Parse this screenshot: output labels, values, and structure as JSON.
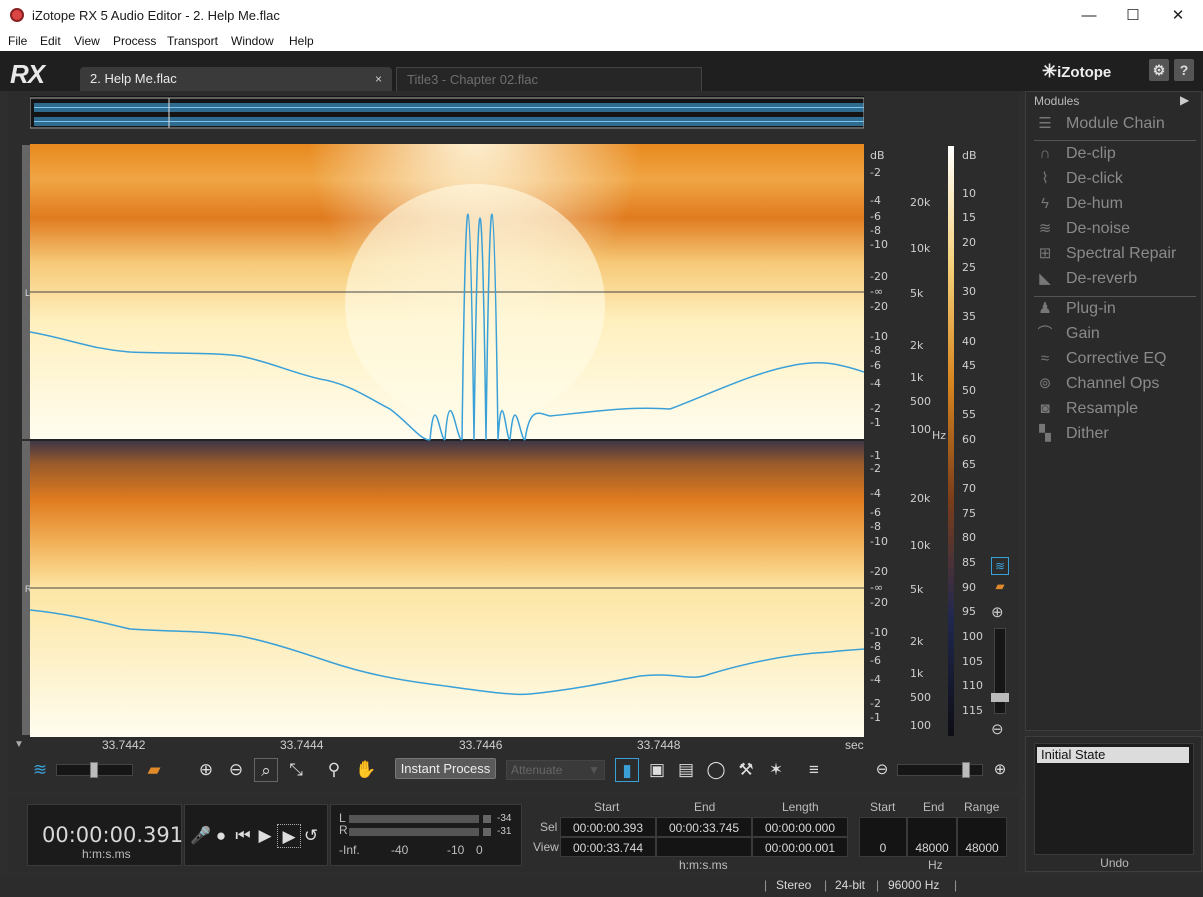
{
  "window": {
    "title": "iZotope RX 5 Audio Editor - 2. Help Me.flac",
    "minimize": "—",
    "maximize": "☐",
    "close": "✕"
  },
  "menu": [
    "File",
    "Edit",
    "View",
    "Process",
    "Transport",
    "Window",
    "Help"
  ],
  "header": {
    "logo": "RX",
    "brand": "iZotope",
    "settings": "⚙",
    "help": "?"
  },
  "tabs": [
    {
      "label": "2. Help Me.flac",
      "close": "×",
      "active": true
    },
    {
      "label": "Title3 - Chapter 02.flac",
      "active": false
    }
  ],
  "channels": [
    "L",
    "R"
  ],
  "db_axis_top": [
    "dB",
    "-2",
    "-4",
    "-6",
    "-8",
    "-10",
    "-20",
    "-∞",
    "-20",
    "-10",
    "-8",
    "-6",
    "-4",
    "-2",
    "-1"
  ],
  "db_axis_bottom": [
    "-1",
    "-2",
    "-4",
    "-6",
    "-8",
    "-10",
    "-20",
    "-∞",
    "-20",
    "-10",
    "-8",
    "-6",
    "-4",
    "-2",
    "-1"
  ],
  "hz_axis_top": [
    "20k",
    "10k",
    "5k",
    "2k",
    "1k",
    "500",
    "100"
  ],
  "hz_axis_bottom": [
    "20k",
    "10k",
    "5k",
    "2k",
    "1k",
    "500",
    "100"
  ],
  "hz_unit": "Hz",
  "colorbar": [
    "dB",
    "10",
    "15",
    "20",
    "25",
    "30",
    "35",
    "40",
    "45",
    "50",
    "55",
    "60",
    "65",
    "70",
    "75",
    "80",
    "85",
    "90",
    "95",
    "100",
    "105",
    "110",
    "115"
  ],
  "time_axis": [
    "33.7442",
    "33.7444",
    "33.7446",
    "33.7448",
    "sec"
  ],
  "toolbar": {
    "instant_process": "Instant Process",
    "attenuate": "Attenuate"
  },
  "transport": {
    "time": "00:00:00.391",
    "time_format": "h:m:s.ms",
    "meter_L": "L",
    "meter_R": "R",
    "peak_L": "-34",
    "peak_R": "-31",
    "meter_scale": [
      "-Inf.",
      "-40",
      "-10",
      "0"
    ]
  },
  "selection": {
    "headers": [
      "Start",
      "End",
      "Length"
    ],
    "sel_label": "Sel",
    "view_label": "View",
    "sel": [
      "00:00:00.393",
      "00:00:33.745",
      "00:00:00.000"
    ],
    "view": [
      "00:00:33.744",
      "",
      "00:00:00.001"
    ],
    "unit": "h:m:s.ms"
  },
  "frequency": {
    "headers": [
      "Start",
      "End",
      "Range"
    ],
    "values": [
      "0",
      "48000",
      "48000"
    ],
    "unit": "Hz"
  },
  "status": {
    "channels": "Stereo",
    "bitdepth": "24-bit",
    "samplerate": "96000 Hz"
  },
  "modules": {
    "header": "Modules",
    "items": [
      {
        "label": "Module Chain",
        "icon": "module-chain-icon",
        "glyph": "☰"
      },
      {
        "label": "De-clip",
        "icon": "de-clip-icon",
        "glyph": "∩"
      },
      {
        "label": "De-click",
        "icon": "de-click-icon",
        "glyph": "⌇"
      },
      {
        "label": "De-hum",
        "icon": "de-hum-icon",
        "glyph": "ϟ"
      },
      {
        "label": "De-noise",
        "icon": "de-noise-icon",
        "glyph": "≋"
      },
      {
        "label": "Spectral Repair",
        "icon": "spectral-repair-icon",
        "glyph": "⊞"
      },
      {
        "label": "De-reverb",
        "icon": "de-reverb-icon",
        "glyph": "◣"
      },
      {
        "label": "Plug-in",
        "icon": "plug-in-icon",
        "glyph": "♟"
      },
      {
        "label": "Gain",
        "icon": "gain-icon",
        "glyph": "⌒"
      },
      {
        "label": "Corrective EQ",
        "icon": "corrective-eq-icon",
        "glyph": "≈"
      },
      {
        "label": "Channel Ops",
        "icon": "channel-ops-icon",
        "glyph": "⊚"
      },
      {
        "label": "Resample",
        "icon": "resample-icon",
        "glyph": "◙"
      },
      {
        "label": "Dither",
        "icon": "dither-icon",
        "glyph": "▚"
      }
    ]
  },
  "history": {
    "items": [
      "Initial State"
    ],
    "undo_label": "Undo"
  },
  "colors": {
    "spectrogram_hot": "#fff6d0",
    "spectrogram_mid": "#e88a2a",
    "spectrogram_cold": "#2a2f45",
    "waveform": "#3aa0d8"
  }
}
